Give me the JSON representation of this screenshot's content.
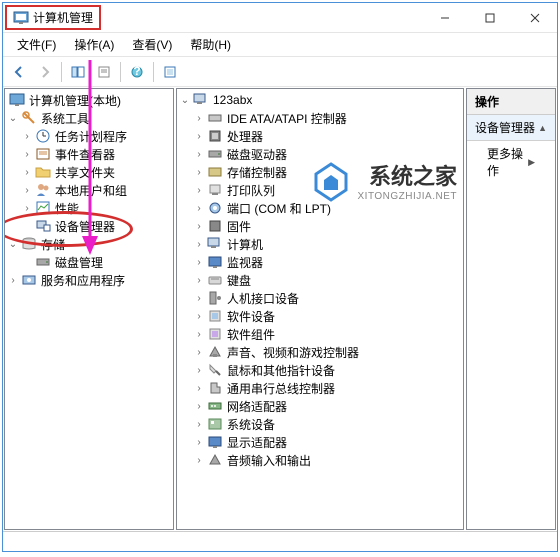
{
  "window": {
    "title": "计算机管理"
  },
  "menu": {
    "file": "文件(F)",
    "action": "操作(A)",
    "view": "查看(V)",
    "help": "帮助(H)"
  },
  "left_tree": {
    "root": "计算机管理(本地)",
    "system_tools": "系统工具",
    "task_scheduler": "任务计划程序",
    "event_viewer": "事件查看器",
    "shared_folders": "共享文件夹",
    "local_users": "本地用户和组",
    "performance": "性能",
    "device_manager": "设备管理器",
    "storage": "存储",
    "disk_management": "磁盘管理",
    "services_apps": "服务和应用程序"
  },
  "mid_tree": {
    "root": "123abx",
    "items": [
      "IDE ATA/ATAPI 控制器",
      "处理器",
      "磁盘驱动器",
      "存储控制器",
      "打印队列",
      "端口 (COM 和 LPT)",
      "固件",
      "计算机",
      "监视器",
      "键盘",
      "人机接口设备",
      "软件设备",
      "软件组件",
      "声音、视频和游戏控制器",
      "鼠标和其他指针设备",
      "通用串行总线控制器",
      "网络适配器",
      "系统设备",
      "显示适配器",
      "音频输入和输出"
    ]
  },
  "right_panel": {
    "header": "操作",
    "sub": "设备管理器",
    "more": "更多操作"
  },
  "watermark": {
    "text": "系统之家",
    "sub": "XITONGZHIJIA.NET"
  }
}
